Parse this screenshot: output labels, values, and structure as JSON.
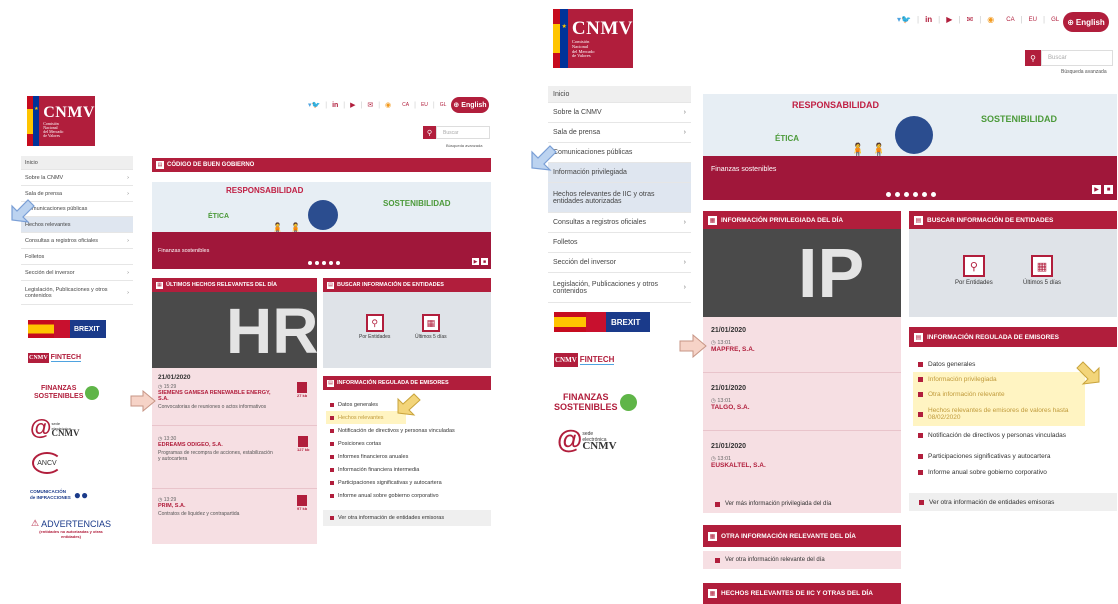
{
  "header": {
    "logo_main": "CNMV",
    "logo_sub": [
      "Comisión",
      "Nacional",
      "del Mercado",
      "de Valores"
    ],
    "social_icons": [
      "twitter-icon",
      "linkedin-icon",
      "youtube-icon",
      "mail-icon",
      "rss-icon"
    ],
    "languages": [
      "CA",
      "EU",
      "GL"
    ],
    "english_label": "English",
    "search_placeholder": "Buscar",
    "advanced_search": "Búsqueda avanzada"
  },
  "left": {
    "sidebar": [
      {
        "label": "Inicio",
        "chevron": false
      },
      {
        "label": "Sobre la CNMV",
        "chevron": true
      },
      {
        "label": "Sala de prensa",
        "chevron": true
      },
      {
        "label": "Comunicaciones públicas",
        "chevron": false
      },
      {
        "label": "Hechos relevantes",
        "chevron": false
      },
      {
        "label": "Consultas a registros oficiales",
        "chevron": true
      },
      {
        "label": "Folletos",
        "chevron": false
      },
      {
        "label": "Sección del inversor",
        "chevron": true
      },
      {
        "label": "Legislación, Publicaciones y otros contenidos",
        "chevron": true
      }
    ],
    "code_bar": "CÓDIGO DE BUEN GOBIERNO",
    "banner": {
      "resp": "RESPONSABILIDAD",
      "etica": "ÉTICA",
      "sost": "SOSTENIBILIDAD",
      "caption": "Finanzas sostenibles"
    },
    "hr_bar": "ÚLTIMOS HECHOS RELEVANTES DEL DÍA",
    "hr_letters": "HR",
    "news": [
      {
        "date": "21/01/2020",
        "time": "15:29",
        "title": "SIEMENS GAMESA RENEWABLE ENERGY, S.A.",
        "desc": "Convocatorias de reuniones o actos informativos",
        "size": "27 kb"
      },
      {
        "date": "",
        "time": "13:30",
        "title": "EDREAMS ODIGEO, S.A.",
        "desc": "Programas de recompra de acciones, estabilización y autocartera",
        "size": "127 kb"
      },
      {
        "date": "",
        "time": "13:29",
        "title": "PRIM, S.A.",
        "desc": "Contratos de liquidez y contrapartida",
        "size": "97 kb"
      }
    ],
    "search_bar": "BUSCAR INFORMACIÓN DE ENTIDADES",
    "search_entities": "Por Entidades",
    "search_days": "Últimos 5 días",
    "reg_bar": "INFORMACIÓN REGULADA DE EMISORES",
    "reg_items": [
      "Datos generales",
      "Hechos relevantes",
      "Notificación de directivos y personas vinculadas",
      "Posiciones cortas",
      "Informes financieros anuales",
      "Información financiera intermedia",
      "Participaciones significativas y autocartera",
      "Informe anual sobre gobierno corporativo"
    ],
    "reg_more": "Ver otra información de entidades emisoras",
    "brands": {
      "brexit": "BREXIT",
      "fintech": "FINTECH",
      "fin_sost_1": "FINANZAS",
      "fin_sost_2": "SOSTENIBLES",
      "sede_1": "sede",
      "sede_2": "electrónica",
      "sede_3": "CNMV",
      "ancv": "ANCV",
      "com_1": "COMUNICACIÓN",
      "com_2": "de INFRACCIONES",
      "adv_title": "ADVERTENCIAS",
      "adv_sub": "(entidades no autorizadas y otras entidades)"
    }
  },
  "right": {
    "sidebar": [
      {
        "label": "Inicio",
        "chevron": false
      },
      {
        "label": "Sobre la CNMV",
        "chevron": true
      },
      {
        "label": "Sala de prensa",
        "chevron": true
      },
      {
        "label": "Comunicaciones públicas",
        "chevron": false
      },
      {
        "label": "Información privilegiada",
        "chevron": false
      },
      {
        "label": "Hechos relevantes de IIC y otras entidades autorizadas",
        "chevron": false
      },
      {
        "label": "Consultas a registros oficiales",
        "chevron": true
      },
      {
        "label": "Folletos",
        "chevron": false
      },
      {
        "label": "Sección del inversor",
        "chevron": true
      },
      {
        "label": "Legislación, Publicaciones y otros contenidos",
        "chevron": true
      }
    ],
    "banner": {
      "resp": "RESPONSABILIDAD",
      "etica": "ÉTICA",
      "sost": "SOSTENIBILIDAD",
      "caption": "Finanzas sostenibles"
    },
    "ip_bar": "INFORMACIÓN PRIVILEGIADA DEL DÍA",
    "ip_letters": "IP",
    "news": [
      {
        "date": "21/01/2020",
        "time": "13:01",
        "title": "MAPFRE, S.A."
      },
      {
        "date": "21/01/2020",
        "time": "13:01",
        "title": "TALGO, S.A."
      },
      {
        "date": "21/01/2020",
        "time": "13:01",
        "title": "EUSKALTEL, S.A."
      }
    ],
    "ip_more": "Ver más información privilegiada del día",
    "search_bar": "BUSCAR INFORMACIÓN DE ENTIDADES",
    "search_entities": "Por Entidades",
    "search_days": "Últimos 5 días",
    "reg_bar": "INFORMACIÓN REGULADA DE EMISORES",
    "reg_items": [
      "Datos generales",
      "Información privilegiada",
      "Otra información relevante",
      "Hechos relevantes de emisores de valores hasta 08/02/2020",
      "Notificación de directivos y personas vinculadas",
      "Participaciones significativas y autocartera",
      "Informe anual sobre gobierno corporativo"
    ],
    "reg_more": "Ver otra información de entidades emisoras",
    "other_bar": "OTRA INFORMACIÓN RELEVANTE DEL DÍA",
    "other_more": "Ver otra información relevante del día",
    "iic_bar": "HECHOS RELEVANTES DE IIC Y OTRAS DEL DÍA",
    "brands": {
      "brexit": "BREXIT",
      "fintech": "FINTECH",
      "fin_sost_1": "FINANZAS",
      "fin_sost_2": "SOSTENIBLES",
      "sede_1": "sede",
      "sede_2": "electrónica",
      "sede_3": "CNMV"
    }
  },
  "colors": {
    "brand": "#b11e3c",
    "highlight": "#fff4c2",
    "sidebar_highlight": "#dfe6f0",
    "arrow_blue": "#8fb3e3",
    "arrow_pink": "#f2c3b6"
  }
}
